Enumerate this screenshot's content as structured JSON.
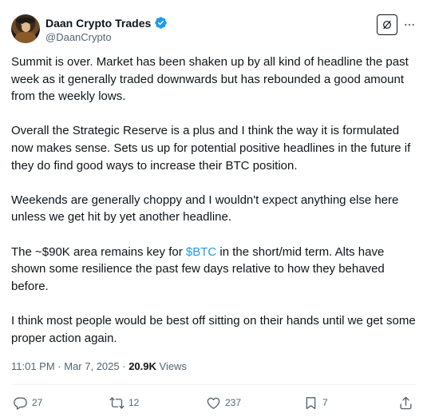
{
  "author": {
    "display_name": "Daan Crypto Trades",
    "handle": "@DaanCrypto",
    "verified_color": "#1d9bf0"
  },
  "tweet": {
    "paragraphs": [
      "Summit is over. Market has been shaken up by all kind of headline the past week as it generally traded downwards but has rebounded a good amount from the weekly lows.",
      "Overall the Strategic Reserve is a plus and I think the way it is formulated now makes sense. Sets us up for potential positive headlines in the future if they do find good ways to increase their BTC position.",
      "Weekends are generally choppy and I wouldn't expect anything else here unless we get hit by yet another headline."
    ],
    "para4_before": "The ~$90K area remains key for ",
    "para4_cashtag": "$BTC",
    "para4_after": " in the short/mid term. Alts have shown some resilience the past few days relative to how they behaved before.",
    "para5": "I think most people would be best off sitting on their hands until we get some proper action again."
  },
  "meta": {
    "time": "11:01 PM",
    "sep1": " · ",
    "date": "Mar 7, 2025",
    "sep2": " · ",
    "views_count": "20.9K",
    "views_label": " Views"
  },
  "actions": {
    "replies": "27",
    "reposts": "12",
    "likes": "237",
    "bookmarks": "7"
  },
  "icons": {
    "grok": "grok-icon",
    "more": "more-icon",
    "reply": "reply-icon",
    "repost": "repost-icon",
    "like": "heart-icon",
    "bookmark": "bookmark-icon",
    "share": "share-icon"
  },
  "colors": {
    "accent": "#1d9bf0",
    "secondary_text": "#536471"
  }
}
